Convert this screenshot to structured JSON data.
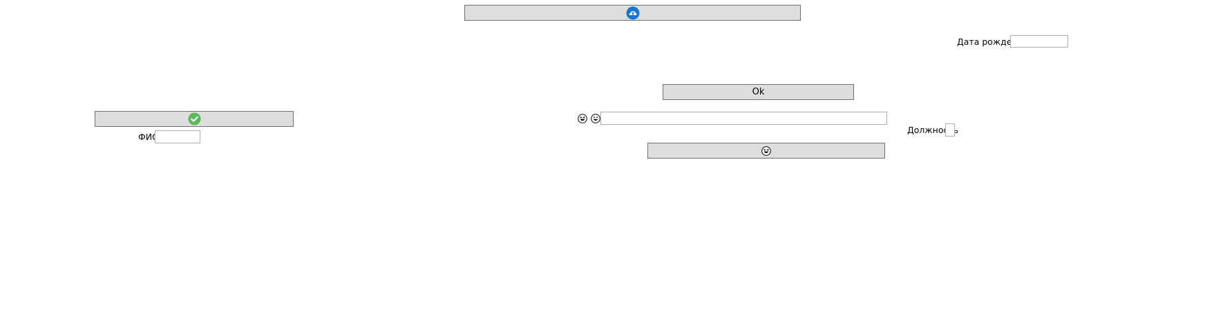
{
  "buttons": {
    "top_icon_button": {
      "icon": "cloud-upload-icon",
      "color": "#1976d2"
    },
    "ok_button": {
      "label": "Ok"
    },
    "check_button": {
      "icon": "check-circle-icon",
      "color": "#5cb85c"
    },
    "emoji_button": {
      "icon": "grinning-squint-emoji-icon"
    }
  },
  "fields": {
    "birth_date": {
      "label": "Дата рождения",
      "value": ""
    },
    "fio": {
      "label": "ФИО",
      "value": ""
    },
    "position": {
      "label": "Должность",
      "value": ""
    },
    "emoji_text": {
      "value": "",
      "icons": [
        "grinning-squint-emoji-icon",
        "smiling-emoji-icon"
      ]
    }
  }
}
